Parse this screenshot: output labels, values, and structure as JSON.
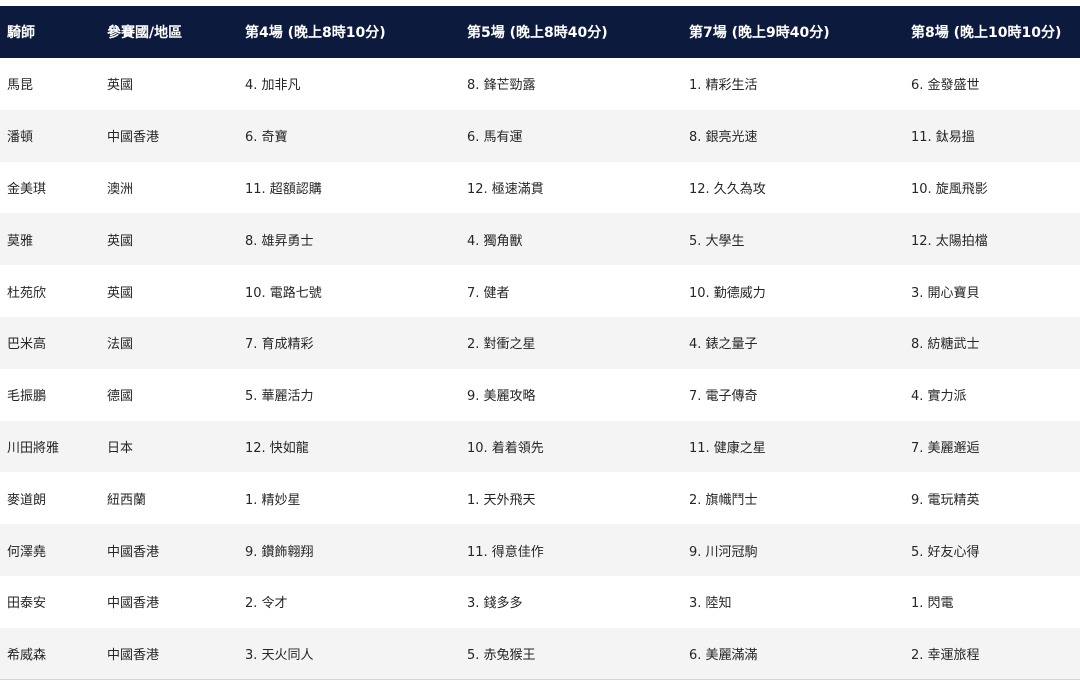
{
  "headers": [
    "騎師",
    "參賽國/地區",
    "第4場 (晚上8時10分)",
    "第5場 (晚上8時40分)",
    "第7場 (晚上9時40分)",
    "第8場 (晚上10時10分)"
  ],
  "rows": [
    {
      "jockey": "馬昆",
      "region": "英國",
      "race4": "4. 加非凡",
      "race5": "8. 鋒芒勁露",
      "race7": "1. 精彩生活",
      "race8": "6. 金發盛世"
    },
    {
      "jockey": "潘頓",
      "region": "中國香港",
      "race4": "6. 奇寶",
      "race5": "6. 馬有運",
      "race7": "8. 銀亮光速",
      "race8": "11. 鈦易搵"
    },
    {
      "jockey": "金美琪",
      "region": "澳洲",
      "race4": "11. 超額認購",
      "race5": "12. 極速滿貫",
      "race7": "12. 久久為攻",
      "race8": "10. 旋風飛影"
    },
    {
      "jockey": "莫雅",
      "region": "英國",
      "race4": "8. 雄昇勇士",
      "race5": "4. 獨角獸",
      "race7": "5. 大學生",
      "race8": "12. 太陽拍檔"
    },
    {
      "jockey": "杜苑欣",
      "region": "英國",
      "race4": "10. 電路七號",
      "race5": "7. 健者",
      "race7": "10. 勤德威力",
      "race8": "3. 開心寶貝"
    },
    {
      "jockey": "巴米高",
      "region": "法國",
      "race4": "7. 育成精彩",
      "race5": "2. 對衝之星",
      "race7": "4. 錶之量子",
      "race8": "8. 紡糖武士"
    },
    {
      "jockey": "毛振鵬",
      "region": "德國",
      "race4": "5. 華麗活力",
      "race5": "9. 美麗攻略",
      "race7": "7. 電子傳奇",
      "race8": "4. 實力派"
    },
    {
      "jockey": "川田將雅",
      "region": "日本",
      "race4": "12. 快如龍",
      "race5": "10. 着着領先",
      "race7": "11. 健康之星",
      "race8": "7. 美麗邂逅"
    },
    {
      "jockey": "麥道朗",
      "region": "紐西蘭",
      "race4": "1. 精妙星",
      "race5": "1. 天外飛天",
      "race7": "2. 旗幟鬥士",
      "race8": "9. 電玩精英"
    },
    {
      "jockey": "何澤堯",
      "region": "中國香港",
      "race4": "9. 鑽飾翱翔",
      "race5": "11. 得意佳作",
      "race7": "9. 川河冠駒",
      "race8": "5. 好友心得"
    },
    {
      "jockey": "田泰安",
      "region": "中國香港",
      "race4": "2. 令才",
      "race5": "3. 錢多多",
      "race7": "3. 陸知",
      "race8": "1. 閃電"
    },
    {
      "jockey": "希威森",
      "region": "中國香港",
      "race4": "3. 天火同人",
      "race5": "5. 赤兔猴王",
      "race7": "6. 美麗滿滿",
      "race8": "2. 幸運旅程"
    }
  ],
  "colors": {
    "header_bg": "#0c1a3d",
    "header_text": "#ffffff",
    "row_alt_bg": "#f4f4f4"
  }
}
